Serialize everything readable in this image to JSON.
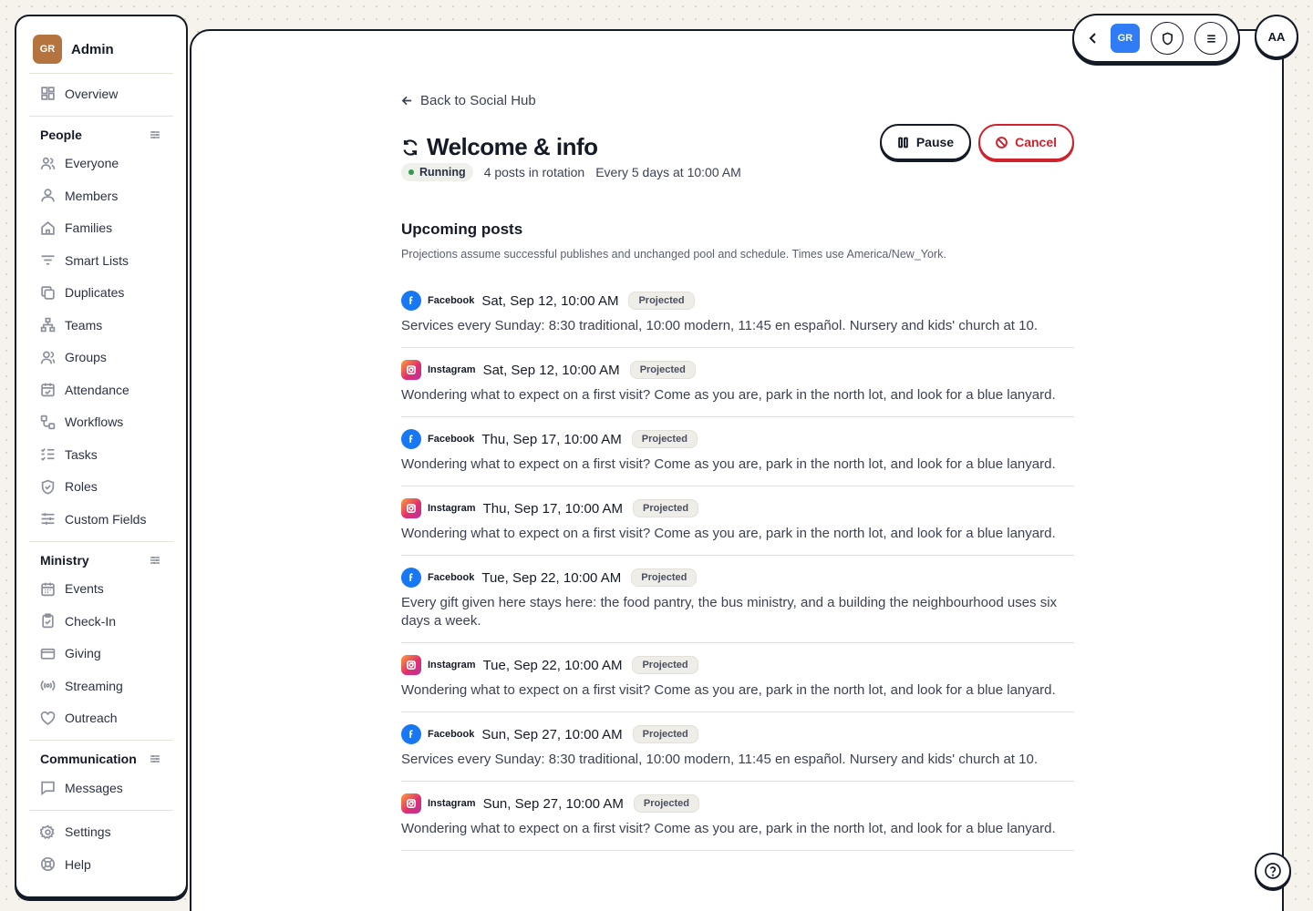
{
  "sidebar": {
    "org": {
      "initials": "GR",
      "name": "Admin"
    },
    "overview": "Overview",
    "sections": [
      {
        "title": "People",
        "items": [
          "Everyone",
          "Members",
          "Families",
          "Smart Lists",
          "Duplicates",
          "Teams",
          "Groups",
          "Attendance",
          "Workflows",
          "Tasks",
          "Roles",
          "Custom Fields"
        ]
      },
      {
        "title": "Ministry",
        "items": [
          "Events",
          "Check-In",
          "Giving",
          "Streaming",
          "Outreach"
        ]
      },
      {
        "title": "Communication",
        "items": [
          "Messages"
        ]
      }
    ],
    "bottom": [
      "Settings",
      "Help"
    ]
  },
  "topbar": {
    "org_initials": "GR",
    "user_initials": "AA"
  },
  "page": {
    "back_label": "Back to Social Hub",
    "title": "Welcome & info",
    "status": "Running",
    "rotation": "4 posts in rotation",
    "schedule": "Every 5 days at 10:00 AM",
    "pause_label": "Pause",
    "cancel_label": "Cancel",
    "section_title": "Upcoming posts",
    "section_subtitle": "Projections assume successful publishes and unchanged pool and schedule. Times use America/New_York."
  },
  "posts": [
    {
      "platform": "Facebook",
      "date": "Sat, Sep 12, 10:00 AM",
      "badge": "Projected",
      "text": "Services every Sunday: 8:30 traditional, 10:00 modern, 11:45 en español. Nursery and kids' church at 10."
    },
    {
      "platform": "Instagram",
      "date": "Sat, Sep 12, 10:00 AM",
      "badge": "Projected",
      "text": "Wondering what to expect on a first visit? Come as you are, park in the north lot, and look for a blue lanyard."
    },
    {
      "platform": "Facebook",
      "date": "Thu, Sep 17, 10:00 AM",
      "badge": "Projected",
      "text": "Wondering what to expect on a first visit? Come as you are, park in the north lot, and look for a blue lanyard."
    },
    {
      "platform": "Instagram",
      "date": "Thu, Sep 17, 10:00 AM",
      "badge": "Projected",
      "text": "Wondering what to expect on a first visit? Come as you are, park in the north lot, and look for a blue lanyard."
    },
    {
      "platform": "Facebook",
      "date": "Tue, Sep 22, 10:00 AM",
      "badge": "Projected",
      "text": "Every gift given here stays here: the food pantry, the bus ministry, and a building the neighbourhood uses six days a week."
    },
    {
      "platform": "Instagram",
      "date": "Tue, Sep 22, 10:00 AM",
      "badge": "Projected",
      "text": "Wondering what to expect on a first visit? Come as you are, park in the north lot, and look for a blue lanyard."
    },
    {
      "platform": "Facebook",
      "date": "Sun, Sep 27, 10:00 AM",
      "badge": "Projected",
      "text": "Services every Sunday: 8:30 traditional, 10:00 modern, 11:45 en español. Nursery and kids' church at 10."
    },
    {
      "platform": "Instagram",
      "date": "Sun, Sep 27, 10:00 AM",
      "badge": "Projected",
      "text": "Wondering what to expect on a first visit? Come as you are, park in the north lot, and look for a blue lanyard."
    }
  ],
  "colors": {
    "accent": "#2f7cf6",
    "danger": "#d0222c",
    "running": "#2e9a52",
    "org_avatar": "#b5743f",
    "facebook": "#1877f2"
  }
}
